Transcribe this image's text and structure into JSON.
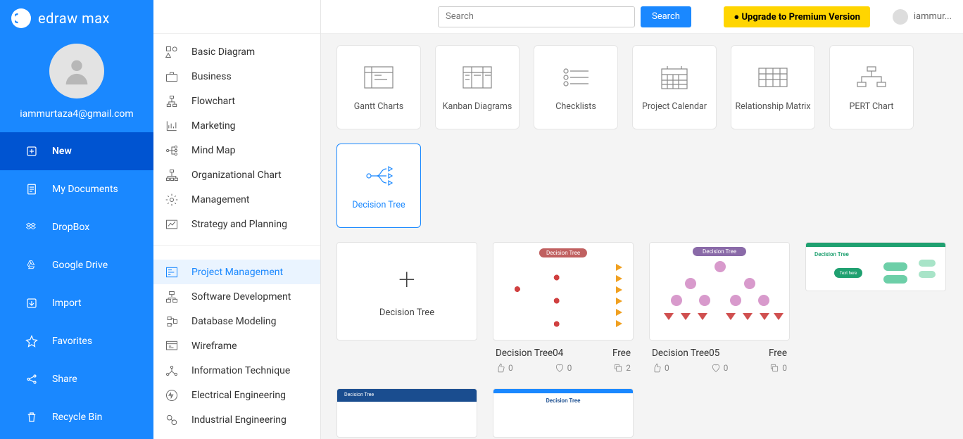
{
  "brand": "edraw max",
  "user": {
    "email": "iammurtaza4@gmail.com",
    "short": "iammur..."
  },
  "search": {
    "placeholder": "Search",
    "btn": "Search"
  },
  "upgrade": "● Upgrade to Premium Version",
  "sidebar": [
    {
      "label": "New",
      "active": true
    },
    {
      "label": "My Documents"
    },
    {
      "label": "DropBox"
    },
    {
      "label": "Google Drive"
    },
    {
      "label": "Import"
    },
    {
      "label": "Favorites"
    },
    {
      "label": "Share"
    },
    {
      "label": "Recycle Bin"
    }
  ],
  "cats1": [
    {
      "label": "Basic Diagram"
    },
    {
      "label": "Business"
    },
    {
      "label": "Flowchart"
    },
    {
      "label": "Marketing"
    },
    {
      "label": "Mind Map"
    },
    {
      "label": "Organizational Chart"
    },
    {
      "label": "Management"
    },
    {
      "label": "Strategy and Planning"
    }
  ],
  "cats2": [
    {
      "label": "Project Management",
      "active": true
    },
    {
      "label": "Software Development"
    },
    {
      "label": "Database Modeling"
    },
    {
      "label": "Wireframe"
    },
    {
      "label": "Information Technique"
    },
    {
      "label": "Electrical Engineering"
    },
    {
      "label": "Industrial Engineering"
    }
  ],
  "tiles": [
    {
      "label": "Gantt Charts"
    },
    {
      "label": "Kanban Diagrams"
    },
    {
      "label": "Checklists"
    },
    {
      "label": "Project Calendar"
    },
    {
      "label": "Relationship Matrix"
    },
    {
      "label": "PERT Chart"
    },
    {
      "label": "Decision Tree",
      "selected": true
    }
  ],
  "newTemplate": "Decision Tree",
  "templates": [
    {
      "name": "Decision Tree04",
      "price": "Free",
      "likes": 0,
      "favs": 0,
      "copies": 2
    },
    {
      "name": "Decision Tree05",
      "price": "Free",
      "likes": 0,
      "favs": 0,
      "copies": 0
    }
  ]
}
